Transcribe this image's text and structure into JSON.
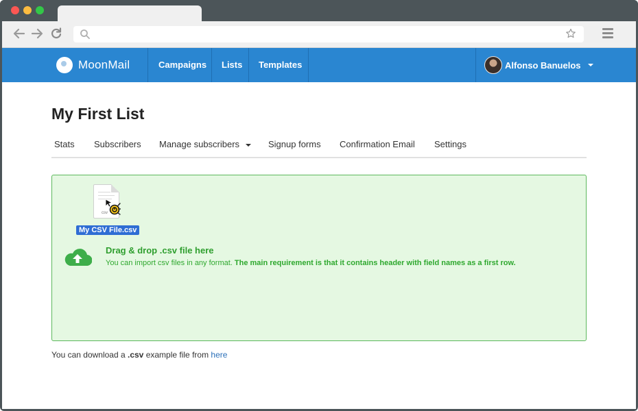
{
  "app": {
    "brand": "MoonMail",
    "nav": [
      {
        "label": "Campaigns"
      },
      {
        "label": "Lists"
      },
      {
        "label": "Templates"
      }
    ],
    "user": {
      "name": "Alfonso Banuelos"
    }
  },
  "page": {
    "title": "My First List",
    "tabs": [
      {
        "label": "Stats"
      },
      {
        "label": "Subscribers"
      },
      {
        "label": "Manage subscribers"
      },
      {
        "label": "Signup forms"
      },
      {
        "label": "Confirmation Email"
      },
      {
        "label": "Settings"
      }
    ]
  },
  "dropzone": {
    "file_name": "My CSV File.csv",
    "file_ext": "csv",
    "title": "Drag & drop .csv file here",
    "desc_plain": "You can import csv files in any format.",
    "desc_bold": "The main requirement is that it contains header with field names as a first row."
  },
  "footer": {
    "prefix": "You can download a",
    "ext": ".csv",
    "middle": "example file from",
    "link": "here"
  },
  "colors": {
    "nav_bg": "#2a86d1",
    "dropzone_bg": "#e5f8e2",
    "dropzone_border": "#5cb85c",
    "success_text": "#2e9e2e",
    "link": "#2a6fb8"
  },
  "icons": [
    "back-arrow-icon",
    "forward-arrow-icon",
    "reload-icon",
    "search-icon",
    "star-icon",
    "hamburger-menu-icon",
    "moonmail-logo-icon",
    "avatar",
    "caret-down-icon",
    "csv-file-icon",
    "drag-cursor-icon",
    "cloud-upload-icon"
  ]
}
